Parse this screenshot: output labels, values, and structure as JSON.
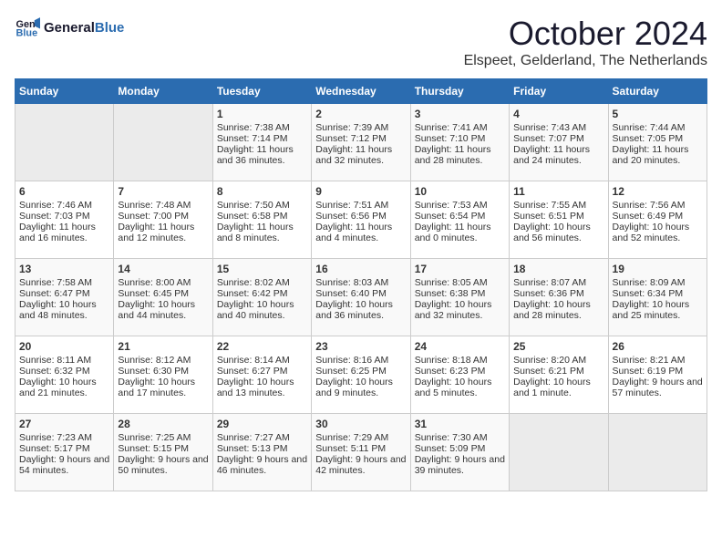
{
  "header": {
    "logo_line1": "General",
    "logo_line2": "Blue",
    "month": "October 2024",
    "location": "Elspeet, Gelderland, The Netherlands"
  },
  "weekdays": [
    "Sunday",
    "Monday",
    "Tuesday",
    "Wednesday",
    "Thursday",
    "Friday",
    "Saturday"
  ],
  "weeks": [
    [
      {
        "day": "",
        "sunrise": "",
        "sunset": "",
        "daylight": ""
      },
      {
        "day": "",
        "sunrise": "",
        "sunset": "",
        "daylight": ""
      },
      {
        "day": "1",
        "sunrise": "Sunrise: 7:38 AM",
        "sunset": "Sunset: 7:14 PM",
        "daylight": "Daylight: 11 hours and 36 minutes."
      },
      {
        "day": "2",
        "sunrise": "Sunrise: 7:39 AM",
        "sunset": "Sunset: 7:12 PM",
        "daylight": "Daylight: 11 hours and 32 minutes."
      },
      {
        "day": "3",
        "sunrise": "Sunrise: 7:41 AM",
        "sunset": "Sunset: 7:10 PM",
        "daylight": "Daylight: 11 hours and 28 minutes."
      },
      {
        "day": "4",
        "sunrise": "Sunrise: 7:43 AM",
        "sunset": "Sunset: 7:07 PM",
        "daylight": "Daylight: 11 hours and 24 minutes."
      },
      {
        "day": "5",
        "sunrise": "Sunrise: 7:44 AM",
        "sunset": "Sunset: 7:05 PM",
        "daylight": "Daylight: 11 hours and 20 minutes."
      }
    ],
    [
      {
        "day": "6",
        "sunrise": "Sunrise: 7:46 AM",
        "sunset": "Sunset: 7:03 PM",
        "daylight": "Daylight: 11 hours and 16 minutes."
      },
      {
        "day": "7",
        "sunrise": "Sunrise: 7:48 AM",
        "sunset": "Sunset: 7:00 PM",
        "daylight": "Daylight: 11 hours and 12 minutes."
      },
      {
        "day": "8",
        "sunrise": "Sunrise: 7:50 AM",
        "sunset": "Sunset: 6:58 PM",
        "daylight": "Daylight: 11 hours and 8 minutes."
      },
      {
        "day": "9",
        "sunrise": "Sunrise: 7:51 AM",
        "sunset": "Sunset: 6:56 PM",
        "daylight": "Daylight: 11 hours and 4 minutes."
      },
      {
        "day": "10",
        "sunrise": "Sunrise: 7:53 AM",
        "sunset": "Sunset: 6:54 PM",
        "daylight": "Daylight: 11 hours and 0 minutes."
      },
      {
        "day": "11",
        "sunrise": "Sunrise: 7:55 AM",
        "sunset": "Sunset: 6:51 PM",
        "daylight": "Daylight: 10 hours and 56 minutes."
      },
      {
        "day": "12",
        "sunrise": "Sunrise: 7:56 AM",
        "sunset": "Sunset: 6:49 PM",
        "daylight": "Daylight: 10 hours and 52 minutes."
      }
    ],
    [
      {
        "day": "13",
        "sunrise": "Sunrise: 7:58 AM",
        "sunset": "Sunset: 6:47 PM",
        "daylight": "Daylight: 10 hours and 48 minutes."
      },
      {
        "day": "14",
        "sunrise": "Sunrise: 8:00 AM",
        "sunset": "Sunset: 6:45 PM",
        "daylight": "Daylight: 10 hours and 44 minutes."
      },
      {
        "day": "15",
        "sunrise": "Sunrise: 8:02 AM",
        "sunset": "Sunset: 6:42 PM",
        "daylight": "Daylight: 10 hours and 40 minutes."
      },
      {
        "day": "16",
        "sunrise": "Sunrise: 8:03 AM",
        "sunset": "Sunset: 6:40 PM",
        "daylight": "Daylight: 10 hours and 36 minutes."
      },
      {
        "day": "17",
        "sunrise": "Sunrise: 8:05 AM",
        "sunset": "Sunset: 6:38 PM",
        "daylight": "Daylight: 10 hours and 32 minutes."
      },
      {
        "day": "18",
        "sunrise": "Sunrise: 8:07 AM",
        "sunset": "Sunset: 6:36 PM",
        "daylight": "Daylight: 10 hours and 28 minutes."
      },
      {
        "day": "19",
        "sunrise": "Sunrise: 8:09 AM",
        "sunset": "Sunset: 6:34 PM",
        "daylight": "Daylight: 10 hours and 25 minutes."
      }
    ],
    [
      {
        "day": "20",
        "sunrise": "Sunrise: 8:11 AM",
        "sunset": "Sunset: 6:32 PM",
        "daylight": "Daylight: 10 hours and 21 minutes."
      },
      {
        "day": "21",
        "sunrise": "Sunrise: 8:12 AM",
        "sunset": "Sunset: 6:30 PM",
        "daylight": "Daylight: 10 hours and 17 minutes."
      },
      {
        "day": "22",
        "sunrise": "Sunrise: 8:14 AM",
        "sunset": "Sunset: 6:27 PM",
        "daylight": "Daylight: 10 hours and 13 minutes."
      },
      {
        "day": "23",
        "sunrise": "Sunrise: 8:16 AM",
        "sunset": "Sunset: 6:25 PM",
        "daylight": "Daylight: 10 hours and 9 minutes."
      },
      {
        "day": "24",
        "sunrise": "Sunrise: 8:18 AM",
        "sunset": "Sunset: 6:23 PM",
        "daylight": "Daylight: 10 hours and 5 minutes."
      },
      {
        "day": "25",
        "sunrise": "Sunrise: 8:20 AM",
        "sunset": "Sunset: 6:21 PM",
        "daylight": "Daylight: 10 hours and 1 minute."
      },
      {
        "day": "26",
        "sunrise": "Sunrise: 8:21 AM",
        "sunset": "Sunset: 6:19 PM",
        "daylight": "Daylight: 9 hours and 57 minutes."
      }
    ],
    [
      {
        "day": "27",
        "sunrise": "Sunrise: 7:23 AM",
        "sunset": "Sunset: 5:17 PM",
        "daylight": "Daylight: 9 hours and 54 minutes."
      },
      {
        "day": "28",
        "sunrise": "Sunrise: 7:25 AM",
        "sunset": "Sunset: 5:15 PM",
        "daylight": "Daylight: 9 hours and 50 minutes."
      },
      {
        "day": "29",
        "sunrise": "Sunrise: 7:27 AM",
        "sunset": "Sunset: 5:13 PM",
        "daylight": "Daylight: 9 hours and 46 minutes."
      },
      {
        "day": "30",
        "sunrise": "Sunrise: 7:29 AM",
        "sunset": "Sunset: 5:11 PM",
        "daylight": "Daylight: 9 hours and 42 minutes."
      },
      {
        "day": "31",
        "sunrise": "Sunrise: 7:30 AM",
        "sunset": "Sunset: 5:09 PM",
        "daylight": "Daylight: 9 hours and 39 minutes."
      },
      {
        "day": "",
        "sunrise": "",
        "sunset": "",
        "daylight": ""
      },
      {
        "day": "",
        "sunrise": "",
        "sunset": "",
        "daylight": ""
      }
    ]
  ]
}
